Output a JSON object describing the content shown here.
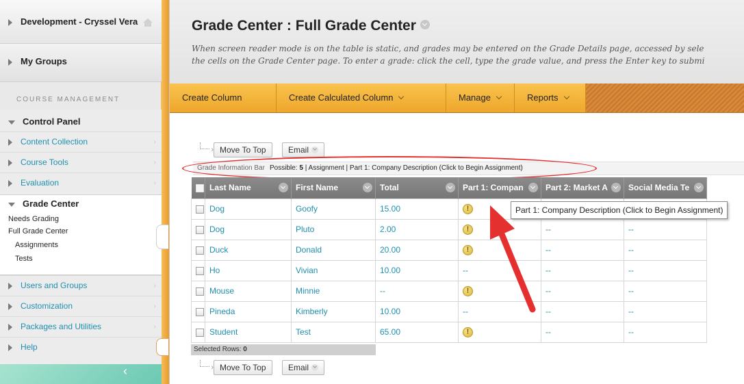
{
  "sidebar": {
    "course_name": "Development - Cryssel Vera",
    "my_groups": "My Groups",
    "course_management": "COURSE MANAGEMENT",
    "control_panel": "Control Panel",
    "items_top": [
      {
        "label": "Content Collection"
      },
      {
        "label": "Course Tools"
      },
      {
        "label": "Evaluation"
      }
    ],
    "grade_center": {
      "label": "Grade Center",
      "needs_grading": "Needs Grading",
      "full_grade_center": "Full Grade Center",
      "assignments": "Assignments",
      "tests": "Tests"
    },
    "items_bottom": [
      {
        "label": "Users and Groups"
      },
      {
        "label": "Customization"
      },
      {
        "label": "Packages and Utilities"
      },
      {
        "label": "Help"
      }
    ]
  },
  "header": {
    "title": "Grade Center : Full Grade Center",
    "description_line1": "When screen reader mode is on the table is static, and grades may be entered on the Grade Details page, accessed by sele",
    "description_line2": "the cells on the Grade Center page. To enter a grade: click the cell, type the grade value, and press the Enter key to submi"
  },
  "action_bar": {
    "create_column": "Create Column",
    "create_calculated_column": "Create Calculated Column",
    "manage": "Manage",
    "reports": "Reports"
  },
  "toolbar": {
    "move_to_top": "Move To Top",
    "email": "Email"
  },
  "info_bar": {
    "label": "Grade Information Bar",
    "possible_label": "Possible:",
    "possible_value": "5",
    "rest": " | Assignment | Part 1: Company Description (Click to Begin Assignment)"
  },
  "grid": {
    "columns": [
      "Last Name",
      "First Name",
      "Total",
      "Part 1: Compan",
      "Part 2: Market A",
      "Social Media Te"
    ],
    "rows": [
      {
        "last": "Dog",
        "first": "Goofy",
        "total": "15.00",
        "p1": "!",
        "p2": "",
        "social": ""
      },
      {
        "last": "Dog",
        "first": "Pluto",
        "total": "2.00",
        "p1": "!",
        "p2": "--",
        "social": "--"
      },
      {
        "last": "Duck",
        "first": "Donald",
        "total": "20.00",
        "p1": "!",
        "p2": "--",
        "social": "--"
      },
      {
        "last": "Ho",
        "first": "Vivian",
        "total": "10.00",
        "p1": "--",
        "p2": "--",
        "social": "--"
      },
      {
        "last": "Mouse",
        "first": "Minnie",
        "total": "--",
        "p1": "!",
        "p2": "--",
        "social": "--"
      },
      {
        "last": "Pineda",
        "first": "Kimberly",
        "total": "10.00",
        "p1": "--",
        "p2": "--",
        "social": "--"
      },
      {
        "last": "Student",
        "first": "Test",
        "total": "65.00",
        "p1": "!",
        "p2": "--",
        "social": "--"
      }
    ],
    "selected_rows_label": "Selected Rows:",
    "selected_rows_value": "0"
  },
  "tooltip": {
    "text": "Part 1:  Company Description (Click to Begin Assignment)"
  },
  "colors": {
    "accent_orange": "#eea72b",
    "link_blue": "#1f8fb0",
    "annotation_red": "#e53030"
  }
}
